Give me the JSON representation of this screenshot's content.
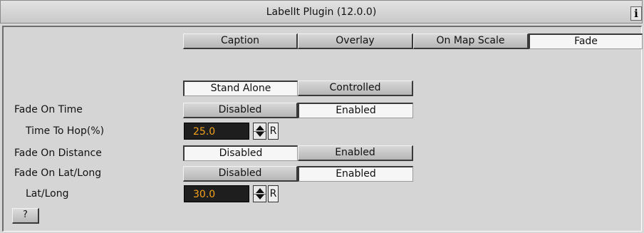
{
  "window": {
    "title": "LabelIt Plugin (12.0.0)",
    "info_label": "i"
  },
  "tabs": [
    {
      "label": "Caption",
      "active": false
    },
    {
      "label": "Overlay",
      "active": false
    },
    {
      "label": "On Map Scale",
      "active": false
    },
    {
      "label": "Fade",
      "active": true
    }
  ],
  "mode": {
    "options": [
      "Stand Alone",
      "Controlled"
    ],
    "selected": "Stand Alone"
  },
  "fade_on_time": {
    "label": "Fade On Time",
    "options": [
      "Disabled",
      "Enabled"
    ],
    "selected": "Enabled"
  },
  "time_to_hop": {
    "label": "Time To Hop(%)",
    "value": "25.0",
    "reset_label": "R"
  },
  "fade_on_distance": {
    "label": "Fade On Distance",
    "options": [
      "Disabled",
      "Enabled"
    ],
    "selected": "Disabled"
  },
  "fade_on_latlong": {
    "label": "Fade On Lat/Long",
    "options": [
      "Disabled",
      "Enabled"
    ],
    "selected": "Enabled"
  },
  "lat_long": {
    "label": "Lat/Long",
    "value": "30.0",
    "reset_label": "R"
  },
  "help": {
    "label": "?"
  }
}
